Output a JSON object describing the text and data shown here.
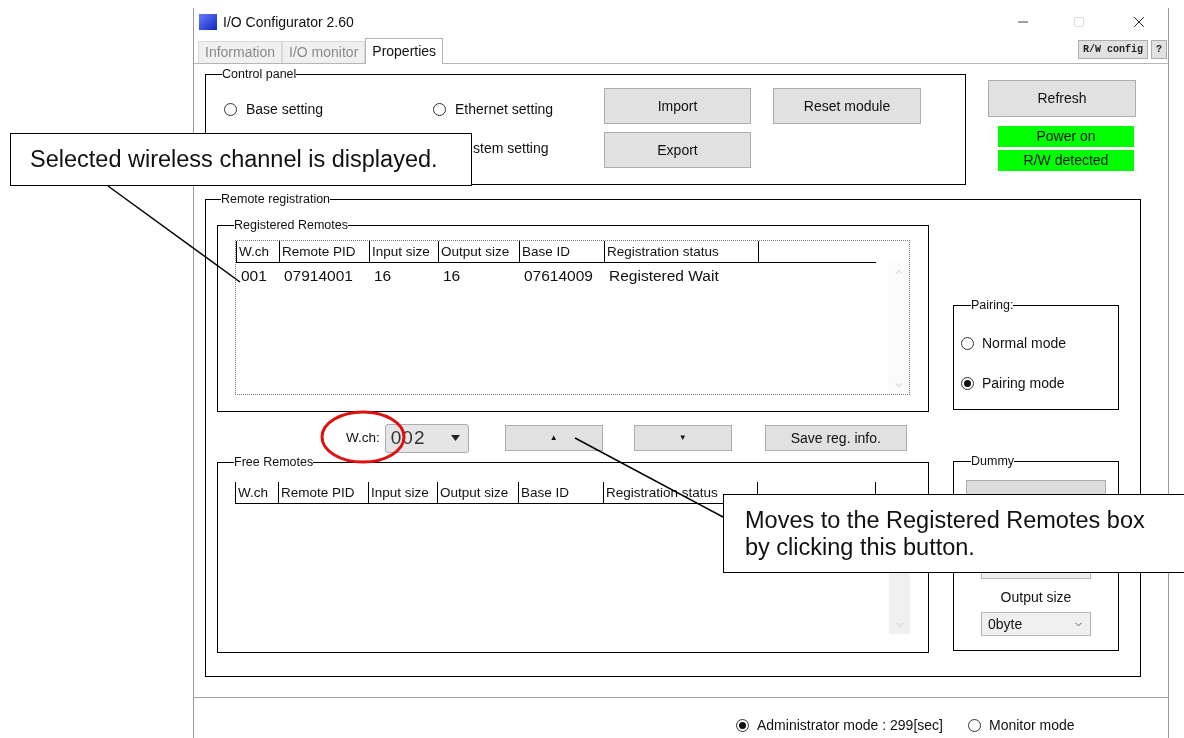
{
  "window": {
    "title": "I/O Configurator 2.60"
  },
  "tabs": [
    {
      "label": "Information",
      "selected": false
    },
    {
      "label": "I/O monitor",
      "selected": false
    },
    {
      "label": "Properties",
      "selected": true
    }
  ],
  "toolbar_buttons": [
    "R/W config",
    "?"
  ],
  "control_panel": {
    "title": "Control panel",
    "options": [
      {
        "label": "Base setting",
        "selected": false
      },
      {
        "label": "Ethernet setting",
        "selected": false
      }
    ],
    "partly_hidden_option": "stem setting",
    "buttons": [
      "Import",
      "Export"
    ],
    "reset_button": "Reset module"
  },
  "refresh_button": "Refresh",
  "indicators": [
    {
      "label": "Power on",
      "on": true
    },
    {
      "label": "R/W detected",
      "on": true
    }
  ],
  "remote_registration": {
    "title": "Remote registration",
    "registered": {
      "title": "Registered Remotes",
      "columns": [
        "W.ch",
        "Remote PID",
        "Input size",
        "Output size",
        "Base ID",
        "Registration status"
      ],
      "rows": [
        [
          "001",
          "07914001",
          "16",
          "16",
          "07614009",
          "Registered Wait"
        ]
      ]
    },
    "channel_label": "W.ch:",
    "channel_value": "002",
    "move_up_button": "▲",
    "move_down_button": "▼",
    "save_button": "Save reg. info.",
    "free": {
      "title": "Free Remotes",
      "columns": [
        "W.ch",
        "Remote PID",
        "Input size",
        "Output size",
        "Base ID",
        "Registration status"
      ]
    },
    "pairing": {
      "title": "Pairing:",
      "options": [
        {
          "label": "Normal mode",
          "selected": false
        },
        {
          "label": "Pairing mode",
          "selected": true
        }
      ]
    },
    "dummy": {
      "title": "Dummy",
      "output_size_label": "Output size",
      "output_size_value": "0byte"
    }
  },
  "mode": {
    "options": [
      {
        "label": "Administrator mode : 299[sec]",
        "selected": true
      },
      {
        "label": "Monitor mode",
        "selected": false
      }
    ]
  },
  "annotations": [
    {
      "text": "Selected wireless channel is displayed."
    },
    {
      "text": "Moves to the Registered Remotes box by clicking this button."
    }
  ]
}
